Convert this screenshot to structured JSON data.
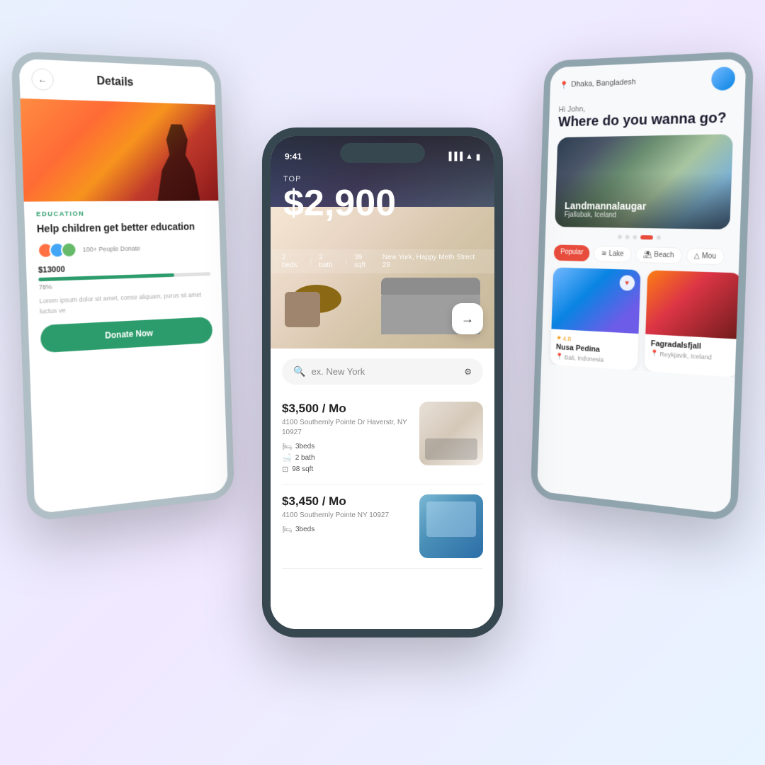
{
  "phones": {
    "left": {
      "header": {
        "back_label": "←",
        "title": "Details"
      },
      "category": "EDUCATION",
      "campaign_title": "Help children get better education",
      "donors_text": "100+ People Donate",
      "amount": "$13000",
      "progress_pct": "78%",
      "description": "Lorem ipsum dolor sit amet, conse aliquam, purus sit amet luctus ve",
      "donate_btn": "Donate Now"
    },
    "center": {
      "status_time": "9:41",
      "hero": {
        "top_label": "TOP",
        "price": "$2,900",
        "beds": "2 beds",
        "bath": "2 bath",
        "sqft": "39 sqft",
        "address": "New York, Happy Meth Strect 29",
        "arrow": "→"
      },
      "search": {
        "placeholder": "ex. New York"
      },
      "listings": [
        {
          "price": "$3,500 / Mo",
          "address": "4100 Southernly Pointe Dr Haverstr, NY 10927",
          "beds": "3beds",
          "bath": "2 bath",
          "sqft": "98 sqft"
        },
        {
          "price": "$3,450 / Mo",
          "address": "4100 Southernly Pointe NY 10927",
          "beds": "3beds"
        }
      ]
    },
    "right": {
      "location": "Dhaka, Bangladesh",
      "greeting_sub": "Hi John,",
      "greeting_main": "Where do you wanna go?",
      "destination": {
        "name": "Landmannalaugar",
        "sub": "Fjallabak, Iceland"
      },
      "filter_tabs": [
        {
          "label": "Popular",
          "active": true
        },
        {
          "label": "Lake",
          "active": false
        },
        {
          "label": "Beach",
          "active": false
        },
        {
          "label": "Mou",
          "active": false
        }
      ],
      "places": [
        {
          "name": "Nusa Pedina",
          "location": "Bali, Indonesia",
          "rating": "4.8"
        },
        {
          "name": "Fagradalsfjall",
          "location": "Reykjavik, Iceland"
        }
      ]
    }
  }
}
